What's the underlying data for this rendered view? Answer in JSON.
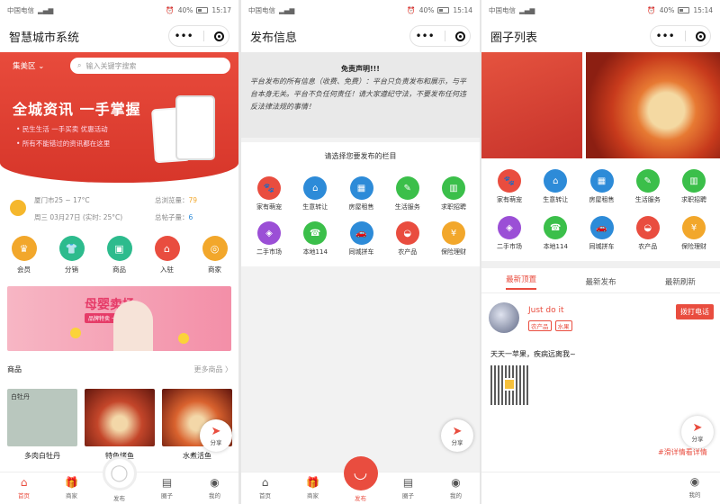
{
  "colors": {
    "brand": "#e94d3f",
    "bg": "#ffffff"
  },
  "statusbar": [
    {
      "carrier": "中国电信",
      "time": "15:17",
      "battery": "40%"
    },
    {
      "carrier": "中国电信",
      "time": "15:14",
      "battery": "40%"
    },
    {
      "carrier": "中国电信",
      "time": "15:14",
      "battery": "40%"
    }
  ],
  "screen1": {
    "title": "智慧城市系统",
    "capsule_more": "•••",
    "district": "集美区",
    "search_placeholder": "输入关键字搜索",
    "hero_title": "全城资讯 一手掌握",
    "hero_b1": "民生生活 一手买卖 优惠活动",
    "hero_b2": "所有不能错过的资讯都在这里",
    "weather_city": "厦门市25 ~ 17°C",
    "weather_date": "周三 03月27日 (实时: 25°C)",
    "views_label": "总浏览量：",
    "views_value": "79",
    "posts_label": "总帖子量：",
    "posts_value": "6",
    "categories": [
      {
        "label": "会员",
        "color": "#f2a72b",
        "icon": "crown-icon",
        "glyph": "♛"
      },
      {
        "label": "分销",
        "color": "#2dbb8d",
        "icon": "shirt-icon",
        "glyph": "👕"
      },
      {
        "label": "商品",
        "color": "#2dbb8d",
        "icon": "goods-icon",
        "glyph": "▣"
      },
      {
        "label": "入驻",
        "color": "#e94d3f",
        "icon": "store-icon",
        "glyph": "⌂"
      },
      {
        "label": "商家",
        "color": "#f2a72b",
        "icon": "merchant-icon",
        "glyph": "◎"
      }
    ],
    "banner_title": "母婴卖场",
    "banner_sub": "品牌特卖 一站购齐",
    "section_title": "商品",
    "section_more": "更多商品 〉",
    "products": [
      {
        "name": "多肉白牡丹",
        "label": "白牡丹",
        "color": "#b9c7be"
      },
      {
        "name": "特色烤鱼",
        "color": "#c4462a"
      },
      {
        "name": "水煮活鱼",
        "color": "#d9622e"
      }
    ],
    "share": "分享",
    "tabbar": [
      {
        "label": "首页",
        "icon": "home-icon",
        "glyph": "⌂"
      },
      {
        "label": "商家",
        "icon": "gift-icon",
        "glyph": "🎁"
      },
      {
        "label": "发布",
        "icon": "publish-icon",
        "glyph": "◯"
      },
      {
        "label": "圈子",
        "icon": "circle-icon",
        "glyph": "▤"
      },
      {
        "label": "我的",
        "icon": "user-icon",
        "glyph": "◉"
      }
    ]
  },
  "screen2": {
    "title": "发布信息",
    "disclaimer_title": "免责声明!!!",
    "disclaimer_body": "平台发布的所有信息（收费、免费）：平台只负责发布和展示，与平台本身无关。平台不负任何责任！请大家遵纪守法，不要发布任何违反法律法规的事情！",
    "choose_title": "请选择您要发布的栏目",
    "grid": [
      {
        "label": "家有萌宠",
        "color": "#e94d3f",
        "icon": "pet-icon",
        "glyph": "🐾"
      },
      {
        "label": "生意转让",
        "color": "#2d8bd8",
        "icon": "transfer-icon",
        "glyph": "⌂"
      },
      {
        "label": "房屋租售",
        "color": "#2d8bd8",
        "icon": "house-icon",
        "glyph": "▦"
      },
      {
        "label": "生活服务",
        "color": "#3bbf4a",
        "icon": "brush-icon",
        "glyph": "✎"
      },
      {
        "label": "求职招聘",
        "color": "#3bbf4a",
        "icon": "book-icon",
        "glyph": "▥"
      },
      {
        "label": "二手市场",
        "color": "#9b4fd6",
        "icon": "bag-icon",
        "glyph": "◈"
      },
      {
        "label": "本地114",
        "color": "#3bbf4a",
        "icon": "phone-icon",
        "glyph": "☎"
      },
      {
        "label": "同城拼车",
        "color": "#2d8bd8",
        "icon": "car-icon",
        "glyph": "🚗"
      },
      {
        "label": "农产品",
        "color": "#e94d3f",
        "icon": "farm-icon",
        "glyph": "◒"
      },
      {
        "label": "保险理财",
        "color": "#f2a72b",
        "icon": "money-icon",
        "glyph": "¥"
      }
    ],
    "share": "分享",
    "tabbar": [
      {
        "label": "首页",
        "icon": "home-icon",
        "glyph": "⌂"
      },
      {
        "label": "商家",
        "icon": "gift-icon",
        "glyph": "🎁"
      },
      {
        "label": "发布",
        "icon": "publish-icon",
        "glyph": "◡"
      },
      {
        "label": "圈子",
        "icon": "circle-icon",
        "glyph": "▤"
      },
      {
        "label": "我的",
        "icon": "user-icon",
        "glyph": "◉"
      }
    ]
  },
  "screen3": {
    "title": "圈子列表",
    "tabs": [
      "最新顶置",
      "最新发布",
      "最新刷新"
    ],
    "post": {
      "user": "Just do it",
      "tags": [
        "农产品",
        "水果"
      ],
      "call": "拨打电话",
      "text": "天天一苹果，疾病远离我~"
    },
    "hint": "#滑详情看详情",
    "share": "分享",
    "tabbar": [
      {
        "label": "我的",
        "icon": "user-icon",
        "glyph": "◉"
      }
    ]
  }
}
